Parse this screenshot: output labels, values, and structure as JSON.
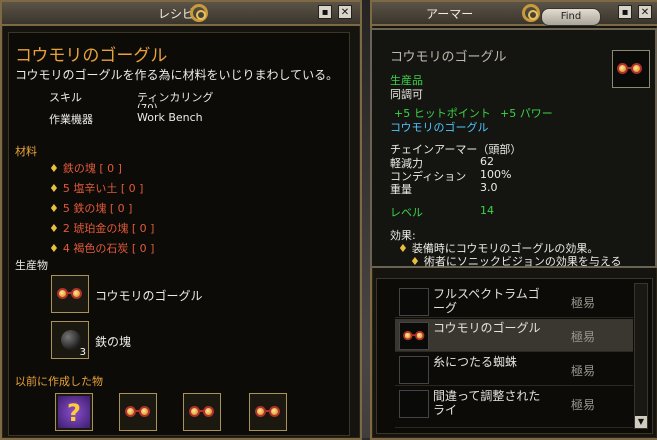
{
  "recipe_window": {
    "title": "レシピ",
    "item_name": "コウモリのゴーグル",
    "description": "コウモリのゴーグルを作る為に材料をいじりまわしている。",
    "skill_label": "スキル",
    "skill_value": "ティンカリング",
    "skill_value_cut": "(70)",
    "tool_label": "作業機器",
    "tool_value": "Work Bench",
    "materials_heading": "材料",
    "materials": [
      "鉄の塊 [ 0 ]",
      "5 塩辛い土 [ 0 ]",
      "5 鉄の塊 [ 0 ]",
      "2 琥珀金の塊 [ 0 ]",
      "4 褐色の石炭 [ 0 ]"
    ],
    "products_heading": "生産物",
    "products": [
      {
        "name": "コウモリのゴーグル",
        "qty": ""
      },
      {
        "name": "鉄の塊",
        "qty": "3"
      }
    ],
    "previous_heading": "以前に作成した物",
    "minimize_label": "▪",
    "close_label": "✕"
  },
  "armor_window": {
    "title": "アーマー",
    "find_label": "Find",
    "minimize_label": "▪",
    "close_label": "✕",
    "rows": [
      {
        "name": "フルスペクトラムゴーグ",
        "difficulty": "極易"
      },
      {
        "name": "コウモリのゴーグル",
        "difficulty": "極易"
      },
      {
        "name": "糸につたる蜘蛛",
        "difficulty": "極易"
      },
      {
        "name": "間違って調整されたライ",
        "difficulty": "極易"
      }
    ],
    "scroll_down_label": "▼"
  },
  "tooltip": {
    "name": "コウモリのゴーグル",
    "crafted": "生産品",
    "tunable": "同調可",
    "bonus1": "+5 ヒットポイント",
    "bonus2": "+5 パワー",
    "set_name": "コウモリのゴーグル",
    "armor_type": "チェインアーマー（頭部）",
    "stat_rows": [
      {
        "label": "軽減力",
        "value": "62"
      },
      {
        "label": "コンディション",
        "value": "100%"
      },
      {
        "label": "重量",
        "value": "3.0"
      }
    ],
    "level_label": "レベル",
    "level_value": "14",
    "effects_heading": "効果:",
    "effect1": "装備時にコウモリのゴーグルの効果。",
    "effect2": "術者にソニックビジョンの効果を与える"
  }
}
